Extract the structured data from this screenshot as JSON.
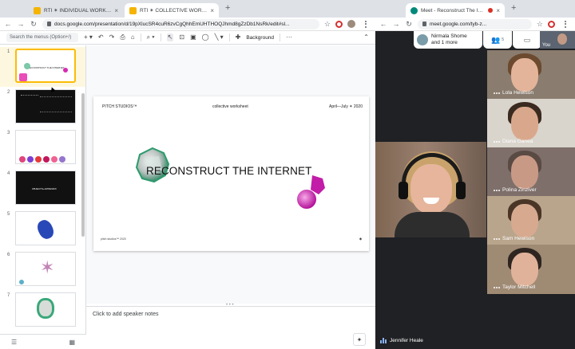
{
  "left_window": {
    "tabs": [
      {
        "title": "RTI ✶ INDIVIDUAL WORKSHEET",
        "active": false
      },
      {
        "title": "RTI ✶ COLLECTIVE WORKSHEET",
        "active": true
      }
    ],
    "url": "docs.google.com/presentation/d/19pXlucSR4cuR6zvCgQhhEmUHTHOQJhmd8gZzDb1NsRk/edit#sl...",
    "toolbar": {
      "search_placeholder": "Search the menus (Option+/)",
      "background_label": "Background"
    },
    "filmstrip": [
      {
        "num": "1",
        "caption": "RECONSTRUCT THE INTERNET"
      },
      {
        "num": "2",
        "caption": ""
      },
      {
        "num": "3",
        "caption": ""
      },
      {
        "num": "4",
        "caption": "OBJECTS+APPENDIX"
      },
      {
        "num": "5",
        "caption": ""
      },
      {
        "num": "6",
        "caption": ""
      },
      {
        "num": "7",
        "caption": ""
      }
    ],
    "slide": {
      "studio": "PITCH STUDIOS™",
      "subtitle": "collective worksheet",
      "dates": "April—July ✶ 2020",
      "title": "RECONSTRUCT THE INTERNET",
      "footer": "pitch studios™ 2020",
      "logo": "✶"
    },
    "notes_placeholder": "Click to add speaker notes"
  },
  "right_window": {
    "tab_title": "Meet - Reconstruct The Inte",
    "url": "meet.google.com/tyb-z...",
    "participants_chip": {
      "line1": "Nirmala Shome",
      "line2": "and 1 more"
    },
    "participant_count": "5",
    "self_label": "You",
    "side_tiles": [
      {
        "name": "Lola Hewison",
        "bg": "#8a7c6e",
        "face": "#e3b49a",
        "hair": "#6b4a30"
      },
      {
        "name": "Diana Ganea",
        "bg": "#d9d4cc",
        "face": "#d9a88c",
        "hair": "#3a2a20"
      },
      {
        "name": "Polina Zinziver",
        "bg": "#7e6f6a",
        "face": "#c89a86",
        "hair": "#5a4a44"
      },
      {
        "name": "Sam Hewison",
        "bg": "#b9a58c",
        "face": "#d7aa90",
        "hair": "#4a3526"
      },
      {
        "name": "Taylor Mitchell",
        "bg": "#9f8a74",
        "face": "#e0b29a",
        "hair": "#2e2520"
      }
    ],
    "main_speaker": "Jennifer Heale"
  }
}
